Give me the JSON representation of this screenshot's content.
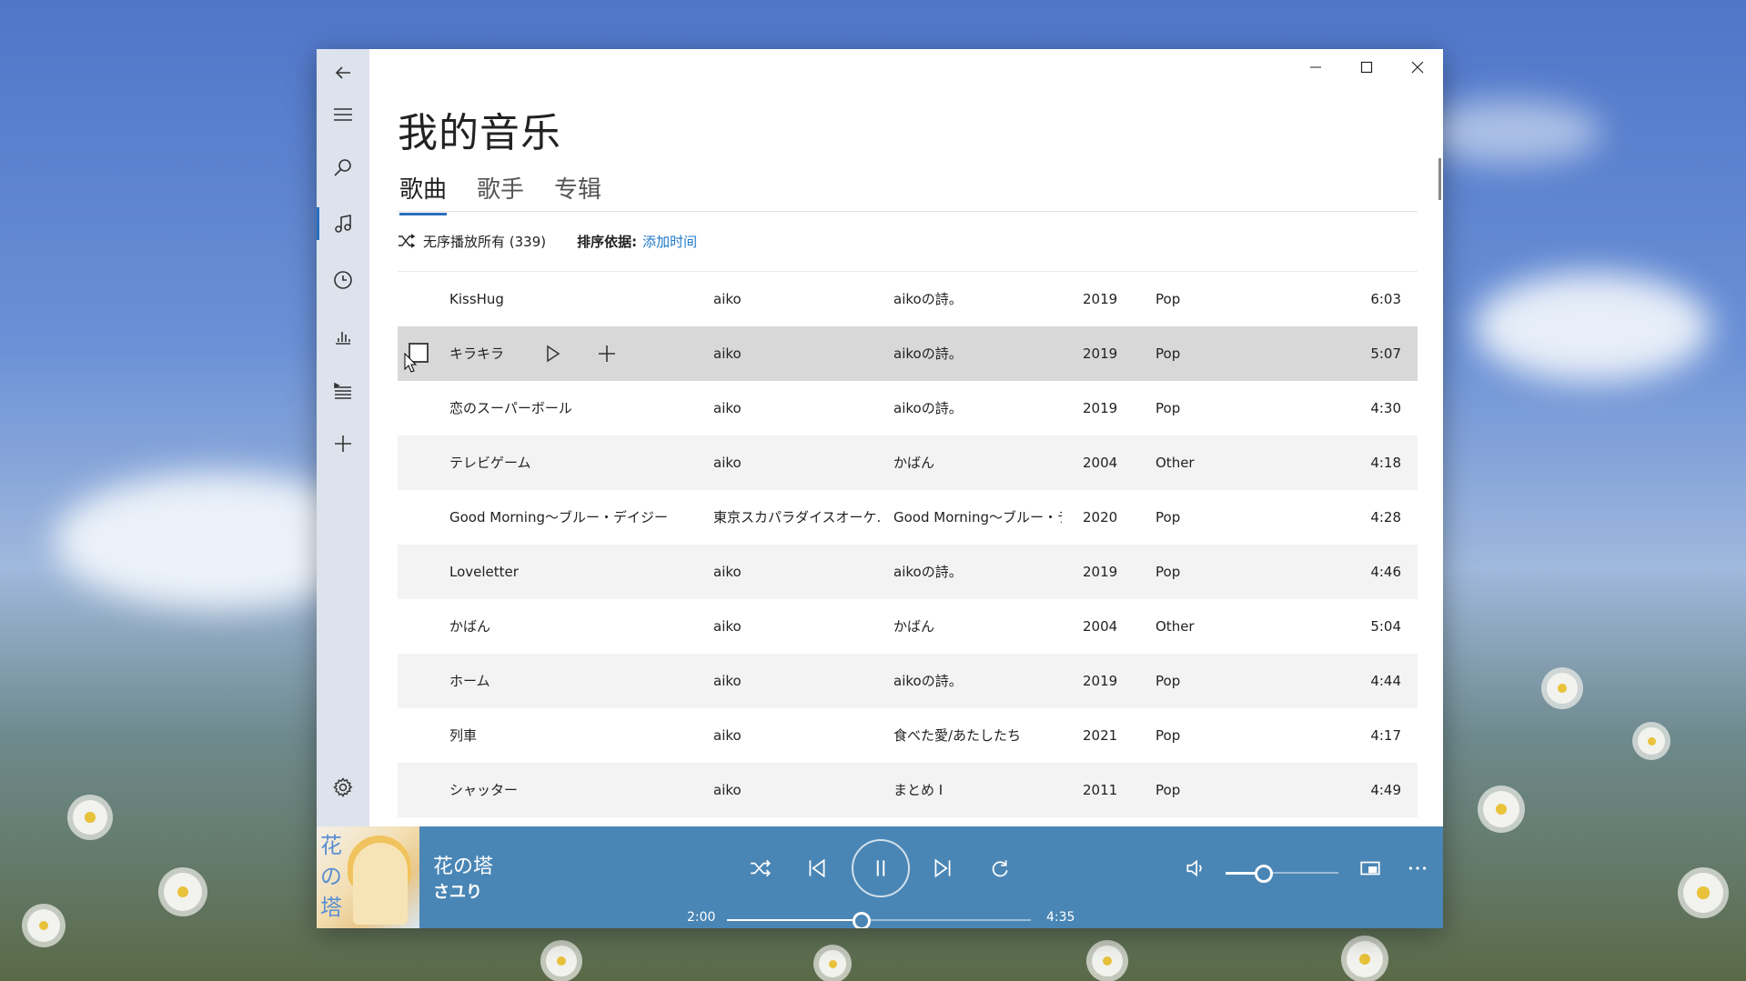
{
  "page": {
    "title": "我的音乐",
    "tabs": [
      {
        "label": "歌曲",
        "active": true
      },
      {
        "label": "歌手",
        "active": false
      },
      {
        "label": "专辑",
        "active": false
      }
    ],
    "shuffle_label": "无序播放所有 (339)",
    "sort_label": "排序依据:",
    "sort_value": "添加时间"
  },
  "sidebar": {
    "items": [
      {
        "icon": "back-arrow-icon"
      },
      {
        "icon": "hamburger-menu-icon"
      },
      {
        "icon": "search-icon"
      },
      {
        "icon": "music-note-icon",
        "active": true
      },
      {
        "icon": "clock-icon"
      },
      {
        "icon": "bar-chart-icon"
      },
      {
        "icon": "playlist-icon"
      },
      {
        "icon": "plus-icon"
      },
      {
        "icon": "gear-icon"
      }
    ]
  },
  "songs": [
    {
      "title": "KissHug",
      "artist": "aiko",
      "album": "aikoの詩。",
      "year": "2019",
      "genre": "Pop",
      "duration": "6:03"
    },
    {
      "title": "キラキラ",
      "artist": "aiko",
      "album": "aikoの詩。",
      "year": "2019",
      "genre": "Pop",
      "duration": "5:07"
    },
    {
      "title": "恋のスーパーボール",
      "artist": "aiko",
      "album": "aikoの詩。",
      "year": "2019",
      "genre": "Pop",
      "duration": "4:30"
    },
    {
      "title": "テレビゲーム",
      "artist": "aiko",
      "album": "かばん",
      "year": "2004",
      "genre": "Other",
      "duration": "4:18"
    },
    {
      "title": "Good Morning～ブルー・デイジー",
      "artist": "東京スカパラダイスオーケ.",
      "album": "Good Morning～ブルー・テ",
      "year": "2020",
      "genre": "Pop",
      "duration": "4:28"
    },
    {
      "title": "Loveletter",
      "artist": "aiko",
      "album": "aikoの詩。",
      "year": "2019",
      "genre": "Pop",
      "duration": "4:46"
    },
    {
      "title": "かばん",
      "artist": "aiko",
      "album": "かばん",
      "year": "2004",
      "genre": "Other",
      "duration": "5:04"
    },
    {
      "title": "ホーム",
      "artist": "aiko",
      "album": "aikoの詩。",
      "year": "2019",
      "genre": "Pop",
      "duration": "4:44"
    },
    {
      "title": "列車",
      "artist": "aiko",
      "album": "食べた愛/あたしたち",
      "year": "2021",
      "genre": "Pop",
      "duration": "4:17"
    },
    {
      "title": "シャッター",
      "artist": "aiko",
      "album": "まとめ I",
      "year": "2011",
      "genre": "Pop",
      "duration": "4:49"
    }
  ],
  "player": {
    "cover_text": [
      "花",
      "の",
      "塔"
    ],
    "title": "花の塔",
    "artist": "さユり",
    "elapsed": "2:00",
    "total": "4:35",
    "progress": 0.44,
    "volume": 0.33,
    "accent": "#4a86b5"
  },
  "colors": {
    "accent": "#2a6fc0",
    "link": "#1e78c8",
    "player_bg": "#4a86b5"
  }
}
